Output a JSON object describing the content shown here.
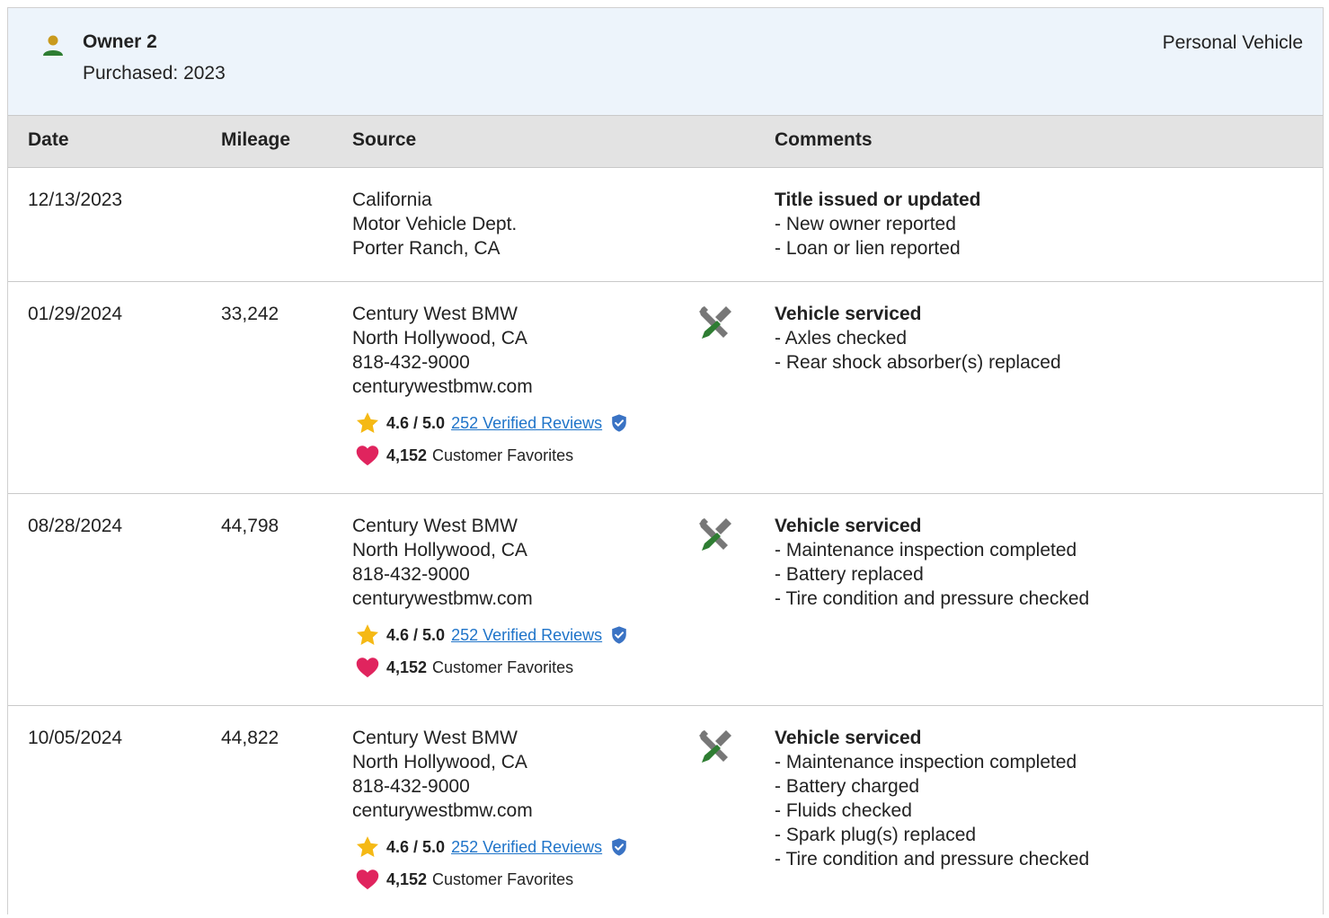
{
  "owner": {
    "name": "Owner 2",
    "purchased": "Purchased: 2023",
    "vehicle_type": "Personal Vehicle"
  },
  "table": {
    "headers": {
      "date": "Date",
      "mileage": "Mileage",
      "source": "Source",
      "comments": "Comments"
    },
    "rows": [
      {
        "date": "12/13/2023",
        "mileage": "",
        "source": [
          "California",
          "Motor Vehicle Dept.",
          "Porter Ranch, CA"
        ],
        "icon": "",
        "comment_title": "Title issued or updated",
        "comments": [
          "- New owner reported",
          "- Loan or lien reported"
        ]
      },
      {
        "date": "01/29/2024",
        "mileage": "33,242",
        "source": [
          "Century West BMW",
          "North Hollywood, CA",
          "818-432-9000",
          "centurywestbmw.com"
        ],
        "rating": "4.6 / 5.0",
        "reviews": "252 Verified Reviews",
        "favorites_count": "4,152",
        "favorites_label": "Customer Favorites",
        "icon": "wrench-screwdriver-icon",
        "comment_title": "Vehicle serviced",
        "comments": [
          "- Axles checked",
          "- Rear shock absorber(s) replaced"
        ]
      },
      {
        "date": "08/28/2024",
        "mileage": "44,798",
        "source": [
          "Century West BMW",
          "North Hollywood, CA",
          "818-432-9000",
          "centurywestbmw.com"
        ],
        "rating": "4.6 / 5.0",
        "reviews": "252 Verified Reviews",
        "favorites_count": "4,152",
        "favorites_label": "Customer Favorites",
        "icon": "wrench-screwdriver-icon",
        "comment_title": "Vehicle serviced",
        "comments": [
          "- Maintenance inspection completed",
          "- Battery replaced",
          "- Tire condition and pressure checked"
        ]
      },
      {
        "date": "10/05/2024",
        "mileage": "44,822",
        "source": [
          "Century West BMW",
          "North Hollywood, CA",
          "818-432-9000",
          "centurywestbmw.com"
        ],
        "rating": "4.6 / 5.0",
        "reviews": "252 Verified Reviews",
        "favorites_count": "4,152",
        "favorites_label": "Customer Favorites",
        "icon": "wrench-screwdriver-icon",
        "comment_title": "Vehicle serviced",
        "comments": [
          "- Maintenance inspection completed",
          "- Battery charged",
          "- Fluids checked",
          "- Spark plug(s) replaced",
          "- Tire condition and pressure checked"
        ]
      }
    ]
  },
  "colors": {
    "header_bg": "#edf4fb",
    "table_head_bg": "#e3e3e3",
    "link": "#1f74c9",
    "star": "#f5b915",
    "heart": "#e0245e",
    "verified": "#3a73c4",
    "person_head": "#c99a1d",
    "person_body": "#2e7d32",
    "wrench_gray": "#777777",
    "screwdriver_green": "#2e7d32"
  }
}
